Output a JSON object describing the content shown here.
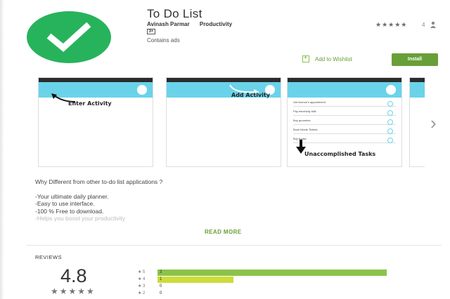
{
  "app": {
    "title": "To Do List",
    "developer": "Avinash Parmar",
    "category": "Productivity",
    "content_rating": "3+",
    "ads_notice": "Contains ads",
    "header_stars": "★★★★★",
    "header_rating_count": "4"
  },
  "actions": {
    "wishlist_label": "Add to Wishlist",
    "install_label": "Install"
  },
  "screenshots": [
    {
      "caption": "Enter Activity"
    },
    {
      "caption": "Add Activity"
    },
    {
      "caption": "Unaccomplished Tasks",
      "tasks": [
        "Get licence's appointment",
        "Pay electricity bills",
        "Buy groceries",
        "Book Movie Tickets",
        "Buy books"
      ]
    }
  ],
  "description": {
    "heading": "Why Different from other to-do list applications ?",
    "lines": [
      "-Your ultimate daily planner.",
      "-Easy to use interface.",
      "-100 % Free to download.",
      "-Helps you boost your productivity"
    ],
    "read_more": "READ MORE"
  },
  "reviews": {
    "heading": "REVIEWS",
    "score": "4.8",
    "stars": "★★★★★",
    "histogram": [
      {
        "label": "★ 5",
        "count": "3",
        "fraction": 1.0,
        "color": "#8bc34a"
      },
      {
        "label": "★ 4",
        "count": "1",
        "fraction": 0.33,
        "color": "#cddc39"
      },
      {
        "label": "★ 3",
        "count": "0",
        "fraction": 0,
        "color": "#ffffff"
      },
      {
        "label": "★ 2",
        "count": "0",
        "fraction": 0,
        "color": "#ffffff"
      }
    ]
  },
  "colors": {
    "install": "#689f38",
    "icon_bg": "#27b35c",
    "app_bar": "#6ad3ea"
  }
}
